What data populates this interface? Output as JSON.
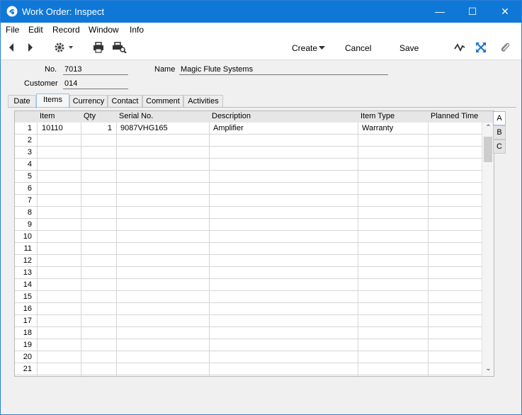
{
  "window": {
    "title": "Work Order: Inspect",
    "minimize": "—",
    "maximize": "☐",
    "close": "✕"
  },
  "menu": [
    "File",
    "Edit",
    "Record",
    "Window",
    "Info"
  ],
  "toolbar": {
    "create": "Create",
    "cancel": "Cancel",
    "save": "Save"
  },
  "header": {
    "no_label": "No.",
    "no_value": "7013",
    "name_label": "Name",
    "name_value": "Magic Flute Systems",
    "customer_label": "Customer",
    "customer_value": "014"
  },
  "tabs": [
    "Date",
    "Items",
    "Currency",
    "Contact",
    "Comment",
    "Activities"
  ],
  "active_tab": "Items",
  "grid": {
    "columns": [
      "Item",
      "Qty",
      "Serial No.",
      "Description",
      "Item Type",
      "Planned Time"
    ],
    "row_numbers": [
      "1",
      "2",
      "3",
      "4",
      "5",
      "6",
      "7",
      "8",
      "9",
      "10",
      "11",
      "12",
      "13",
      "14",
      "15",
      "16",
      "17",
      "18",
      "19",
      "20",
      "21"
    ],
    "rows": [
      {
        "item": "10110",
        "qty": "1",
        "serial": "9087VHG165",
        "description": "Amplifier",
        "item_type": "Warranty",
        "planned_time": ""
      }
    ]
  },
  "side_tabs": [
    "A",
    "B",
    "C"
  ],
  "active_side_tab": "A"
}
